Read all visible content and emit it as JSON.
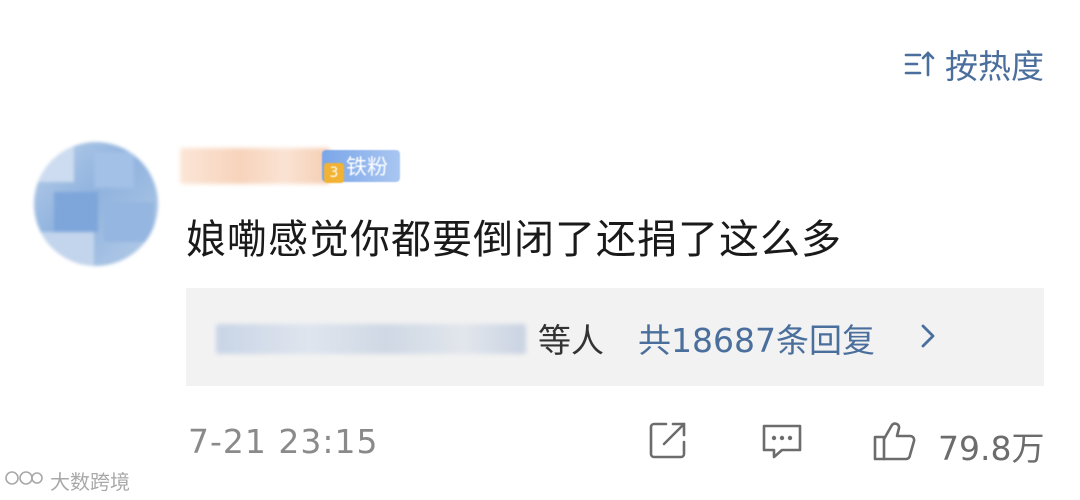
{
  "sort": {
    "label": "按热度",
    "icon": "sort-icon"
  },
  "comment": {
    "avatar_icon": "avatar-blurred",
    "badge": {
      "level": "3",
      "label": "铁粉"
    },
    "text": "娘嘞感觉你都要倒闭了还捐了这么多",
    "timestamp": "7-21 23:15"
  },
  "replies": {
    "suffix": "等人",
    "count_label": "共18687条回复",
    "chevron_icon": "chevron-right-icon"
  },
  "actions": {
    "share_icon": "share-icon",
    "comment_icon": "comment-icon",
    "like_icon": "thumbs-up-icon",
    "like_count": "79.8万"
  },
  "watermark": {
    "text": "大数跨境"
  },
  "colors": {
    "accent": "#4a6f9c",
    "reply_bg": "#f2f2f2",
    "text": "#1a1a1a",
    "muted": "#8a8a8a"
  }
}
